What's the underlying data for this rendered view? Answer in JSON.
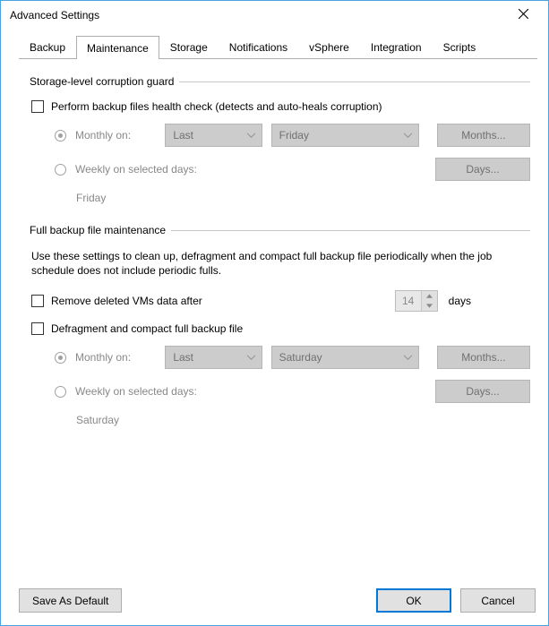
{
  "window": {
    "title": "Advanced Settings"
  },
  "tabs": {
    "backup": "Backup",
    "maintenance": "Maintenance",
    "storage": "Storage",
    "notifications": "Notifications",
    "vsphere": "vSphere",
    "integration": "Integration",
    "scripts": "Scripts"
  },
  "guard": {
    "group": "Storage-level corruption guard",
    "checkbox": "Perform backup files health check (detects and auto-heals corruption)",
    "monthly_label": "Monthly on:",
    "week": "Last",
    "day": "Friday",
    "months_btn": "Months...",
    "weekly_label": "Weekly on selected days:",
    "days_btn": "Days...",
    "selected_note": "Friday"
  },
  "full": {
    "group": "Full backup file maintenance",
    "desc": "Use these settings to clean up, defragment and compact full backup file periodically when the job schedule does not include periodic fulls.",
    "remove_label": "Remove deleted VMs data after",
    "remove_value": "14",
    "remove_unit": "days",
    "defrag_label": "Defragment and compact full backup file",
    "monthly_label": "Monthly on:",
    "week": "Last",
    "day": "Saturday",
    "months_btn": "Months...",
    "weekly_label": "Weekly on selected days:",
    "days_btn": "Days...",
    "selected_note": "Saturday"
  },
  "footer": {
    "save": "Save As Default",
    "ok": "OK",
    "cancel": "Cancel"
  }
}
